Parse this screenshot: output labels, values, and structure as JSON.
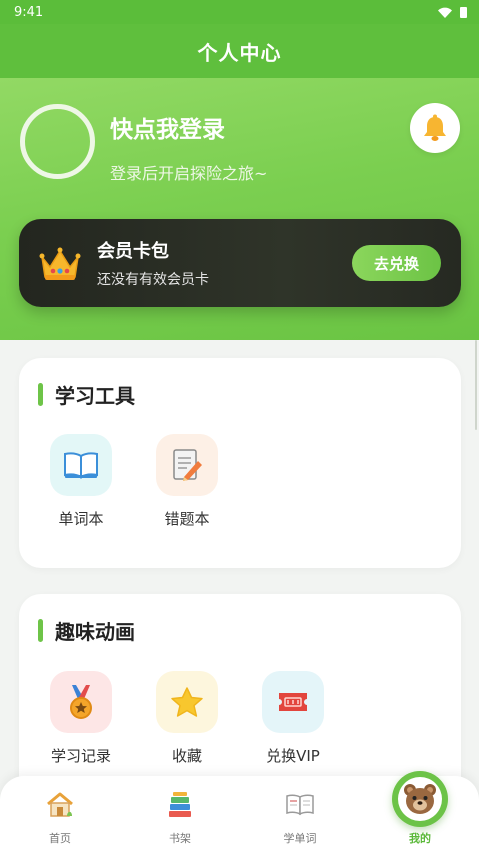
{
  "status": {
    "time": "9:41"
  },
  "nav": {
    "title": "个人中心"
  },
  "profile": {
    "login_title": "快点我登录",
    "login_subtitle": "登录后开启探险之旅~"
  },
  "vip": {
    "title": "会员卡包",
    "subtitle": "还没有有效会员卡",
    "button": "去兑换"
  },
  "tools": {
    "title": "学习工具",
    "items": [
      {
        "label": "单词本",
        "icon": "open-book-icon",
        "bg": "#e3f7f7"
      },
      {
        "label": "错题本",
        "icon": "notepad-pencil-icon",
        "bg": "#fdf0e6"
      }
    ]
  },
  "fun": {
    "title": "趣味动画",
    "items": [
      {
        "label": "学习记录",
        "icon": "medal-icon",
        "bg": "#fde6e6"
      },
      {
        "label": "收藏",
        "icon": "star-icon",
        "bg": "#fdf6dd"
      },
      {
        "label": "兑换VIP",
        "icon": "ticket-icon",
        "bg": "#e4f5f9"
      }
    ]
  },
  "tabbar": {
    "items": [
      {
        "label": "首页",
        "icon": "house-icon"
      },
      {
        "label": "书架",
        "icon": "books-icon"
      },
      {
        "label": "学单词",
        "icon": "open-book-icon"
      },
      {
        "label": "我的",
        "icon": "bear-icon",
        "active": true
      }
    ]
  },
  "colors": {
    "accent": "#6cc347",
    "header": "#5fbf3d",
    "card_dark": "#262922"
  }
}
